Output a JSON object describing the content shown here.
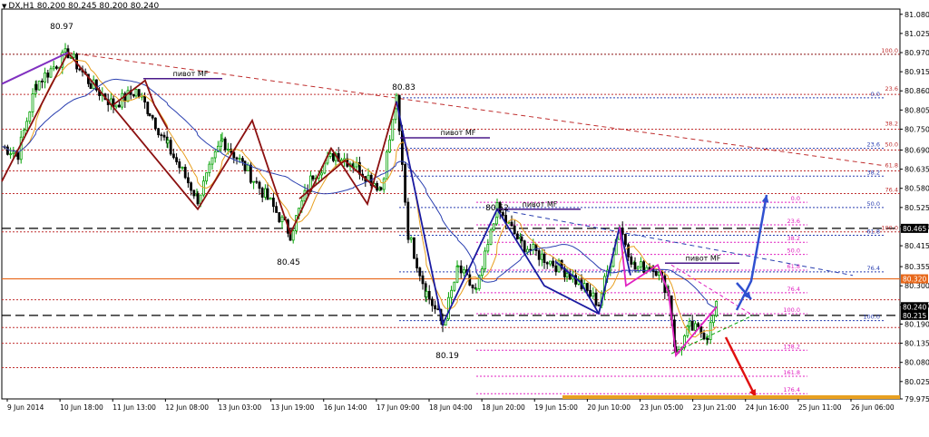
{
  "header": {
    "symbol_arrow": "▼",
    "text": "DX,H1  80.200 80.245 80.200 80.240"
  },
  "chart_data": {
    "type": "candlestick",
    "symbol": "DX",
    "timeframe": "H1",
    "ohlc": {
      "open": 80.2,
      "high": 80.245,
      "low": 80.2,
      "close": 80.24
    },
    "ylim": [
      79.975,
      81.095
    ],
    "y_ticks": [
      "81.080",
      "81.025",
      "80.970",
      "80.915",
      "80.860",
      "80.805",
      "80.750",
      "80.690",
      "80.635",
      "80.580",
      "80.525",
      "80.470",
      "80.415",
      "80.355",
      "80.300",
      "80.245",
      "80.190",
      "80.135",
      "80.080",
      "80.025",
      "79.975"
    ],
    "x_ticks": [
      "9 Jun 2014",
      "10 Jun 18:00",
      "11 Jun 13:00",
      "12 Jun 08:00",
      "13 Jun 03:00",
      "13 Jun 19:00",
      "16 Jun 14:00",
      "17 Jun 09:00",
      "18 Jun 04:00",
      "18 Jun 20:00",
      "19 Jun 15:00",
      "20 Jun 10:00",
      "23 Jun 05:00",
      "23 Jun 21:00",
      "24 Jun 16:00",
      "25 Jun 11:00",
      "26 Jun 06:00"
    ],
    "price_badges": [
      {
        "price": 80.465,
        "label": "80.465",
        "bg": "#000000"
      },
      {
        "price": 80.32,
        "label": "80.320",
        "bg": "#e8681a"
      },
      {
        "price": 80.24,
        "label": "80.240",
        "bg": "#000000"
      },
      {
        "price": 80.215,
        "label": "80.215",
        "bg": "#000000"
      }
    ],
    "swing_labels": [
      {
        "label": "80.97",
        "price": 80.97
      },
      {
        "label": "80.45",
        "price": 80.45
      },
      {
        "label": "80.83",
        "price": 80.83
      },
      {
        "label": "80.52",
        "price": 80.52
      },
      {
        "label": "80.19",
        "price": 80.19
      }
    ],
    "pivot_labels": [
      "пивот MF",
      "пивот MF",
      "пивот MF",
      "пивот MF"
    ],
    "fib_levels_1": [
      "100.0",
      "0.0",
      "23.6",
      "38.2",
      "50.0",
      "61.8",
      "76.4",
      "100.0",
      "23.6",
      "38.2",
      "50.0",
      "61.8",
      "76.4",
      "100.0"
    ],
    "fib_levels_2": [
      "0.0",
      "23.6",
      "38.2",
      "50.0",
      "61.8",
      "76.4",
      "100.0",
      "138.2",
      "161.8",
      "176.4"
    ],
    "fib_levels_3": [
      "138.2",
      "161.8",
      "176.4"
    ],
    "colors": {
      "up": "#00a000",
      "down": "#000000",
      "ma_fast": "#e8a020",
      "ma_slow": "#2a3fb0",
      "zigzag": "#8b1010",
      "pattern_blue": "#1a1aa0",
      "pattern_pink": "#e020c0",
      "accent_orange": "#e8681a"
    }
  }
}
